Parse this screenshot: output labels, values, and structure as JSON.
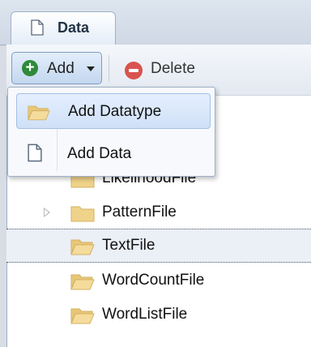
{
  "tab": {
    "label": "Data"
  },
  "toolbar": {
    "add_label": "Add",
    "delete_label": "Delete"
  },
  "tree": {
    "items": [
      {
        "label": "LikelihoodFile",
        "expandable": false,
        "selected": false
      },
      {
        "label": "PatternFile",
        "expandable": true,
        "selected": false
      },
      {
        "label": "TextFile",
        "expandable": false,
        "selected": true
      },
      {
        "label": "WordCountFile",
        "expandable": false,
        "selected": false
      },
      {
        "label": "WordListFile",
        "expandable": false,
        "selected": false
      }
    ]
  },
  "menu": {
    "items": [
      {
        "label": "Add Datatype",
        "icon": "folder-icon",
        "active": true
      },
      {
        "label": "Add Data",
        "icon": "document-icon",
        "active": false
      }
    ]
  },
  "colors": {
    "accent": "#c3d7ef",
    "add_icon": "#2e8a3a",
    "delete_icon": "#d9534f",
    "folder": "#f0d38a",
    "selection_bg": "#ebeff6"
  }
}
